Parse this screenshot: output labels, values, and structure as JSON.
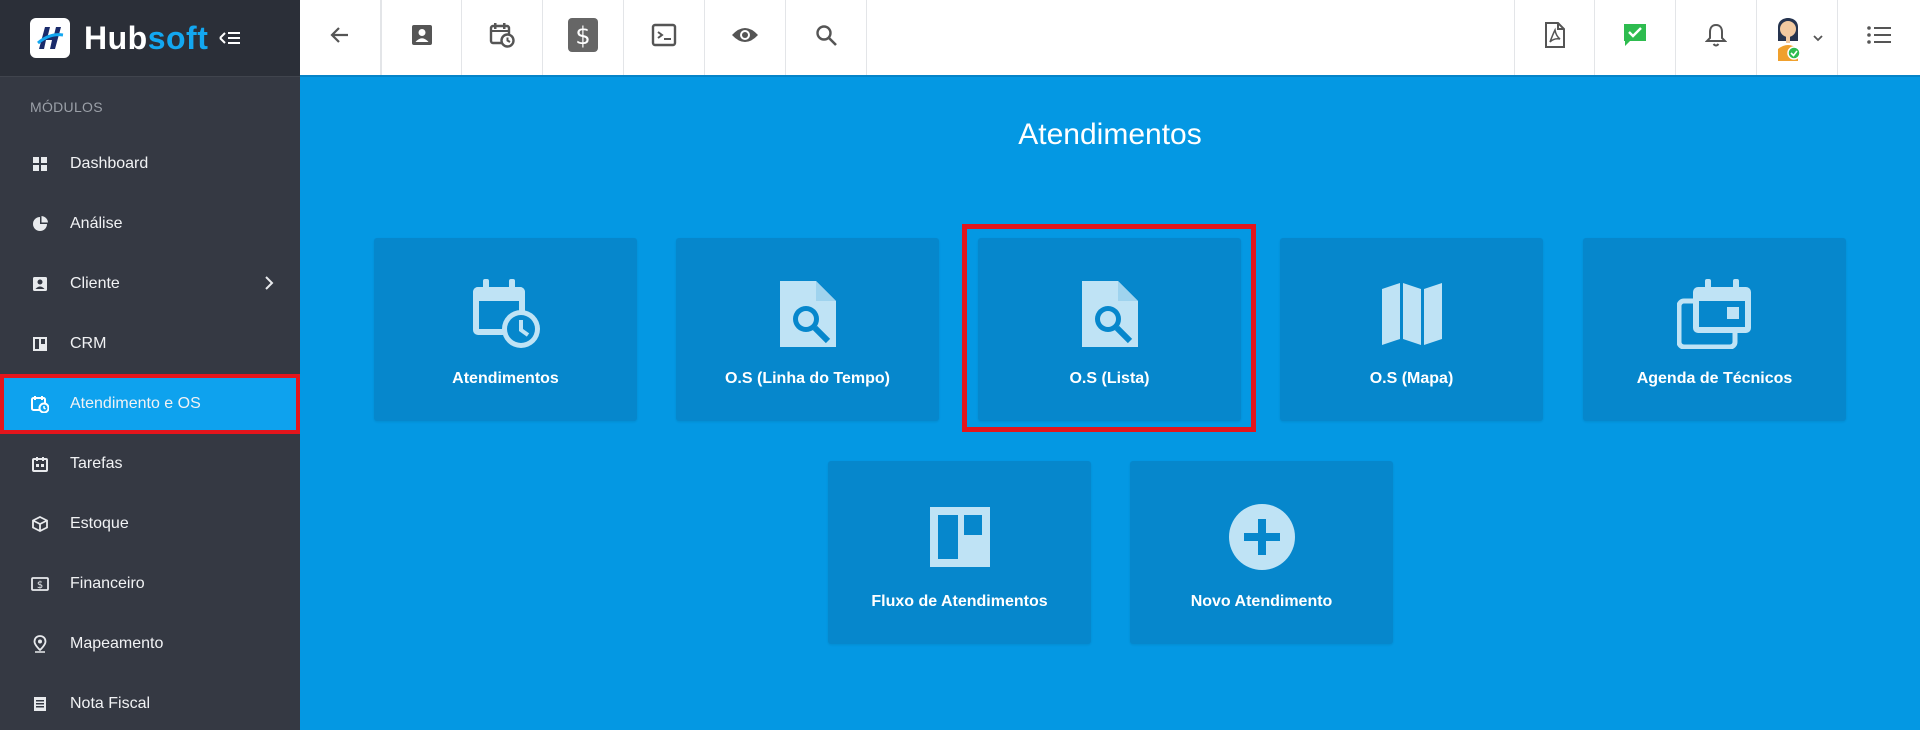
{
  "brand": {
    "name_part1": "Hub",
    "name_part2": "soft"
  },
  "sidebar": {
    "section_title": "MÓDULOS",
    "items": [
      {
        "label": "Dashboard",
        "icon": "dashboard-icon"
      },
      {
        "label": "Análise",
        "icon": "pie-chart-icon"
      },
      {
        "label": "Cliente",
        "icon": "contact-card-icon"
      },
      {
        "label": "CRM",
        "icon": "kanban-icon"
      },
      {
        "label": "Atendimento e OS",
        "icon": "calendar-clock-icon",
        "active": true
      },
      {
        "label": "Tarefas",
        "icon": "tasks-icon"
      },
      {
        "label": "Estoque",
        "icon": "box-icon"
      },
      {
        "label": "Financeiro",
        "icon": "money-icon"
      },
      {
        "label": "Mapeamento",
        "icon": "map-pin-icon"
      },
      {
        "label": "Nota Fiscal",
        "icon": "document-icon"
      }
    ]
  },
  "topbar": {
    "left_icons": [
      "back-arrow-icon",
      "contact-card-icon",
      "calendar-clock-icon",
      "dollar-icon",
      "terminal-icon",
      "eye-icon",
      "search-icon"
    ],
    "right_icons": [
      "pdf-icon",
      "chat-check-icon",
      "bell-icon",
      "avatar",
      "list-icon"
    ]
  },
  "main": {
    "title": "Atendimentos",
    "cards": [
      {
        "label": "Atendimentos",
        "icon": "calendar-clock-icon"
      },
      {
        "label": "O.S (Linha do Tempo)",
        "icon": "file-search-icon"
      },
      {
        "label": "O.S (Lista)",
        "icon": "file-search-icon"
      },
      {
        "label": "O.S (Mapa)",
        "icon": "map-icon"
      },
      {
        "label": "Agenda de Técnicos",
        "icon": "calendar-stack-icon"
      },
      {
        "label": "Fluxo de Atendimentos",
        "icon": "kanban-board-icon"
      },
      {
        "label": "Novo Atendimento",
        "icon": "plus-circle-icon"
      }
    ]
  },
  "colors": {
    "sidebar_bg": "#353943",
    "main_bg": "#0498e3",
    "card_bg": "#0687cc",
    "active_item": "#0ea2ee",
    "highlight": "#e4151c",
    "brand_accent": "#13a7f0"
  }
}
